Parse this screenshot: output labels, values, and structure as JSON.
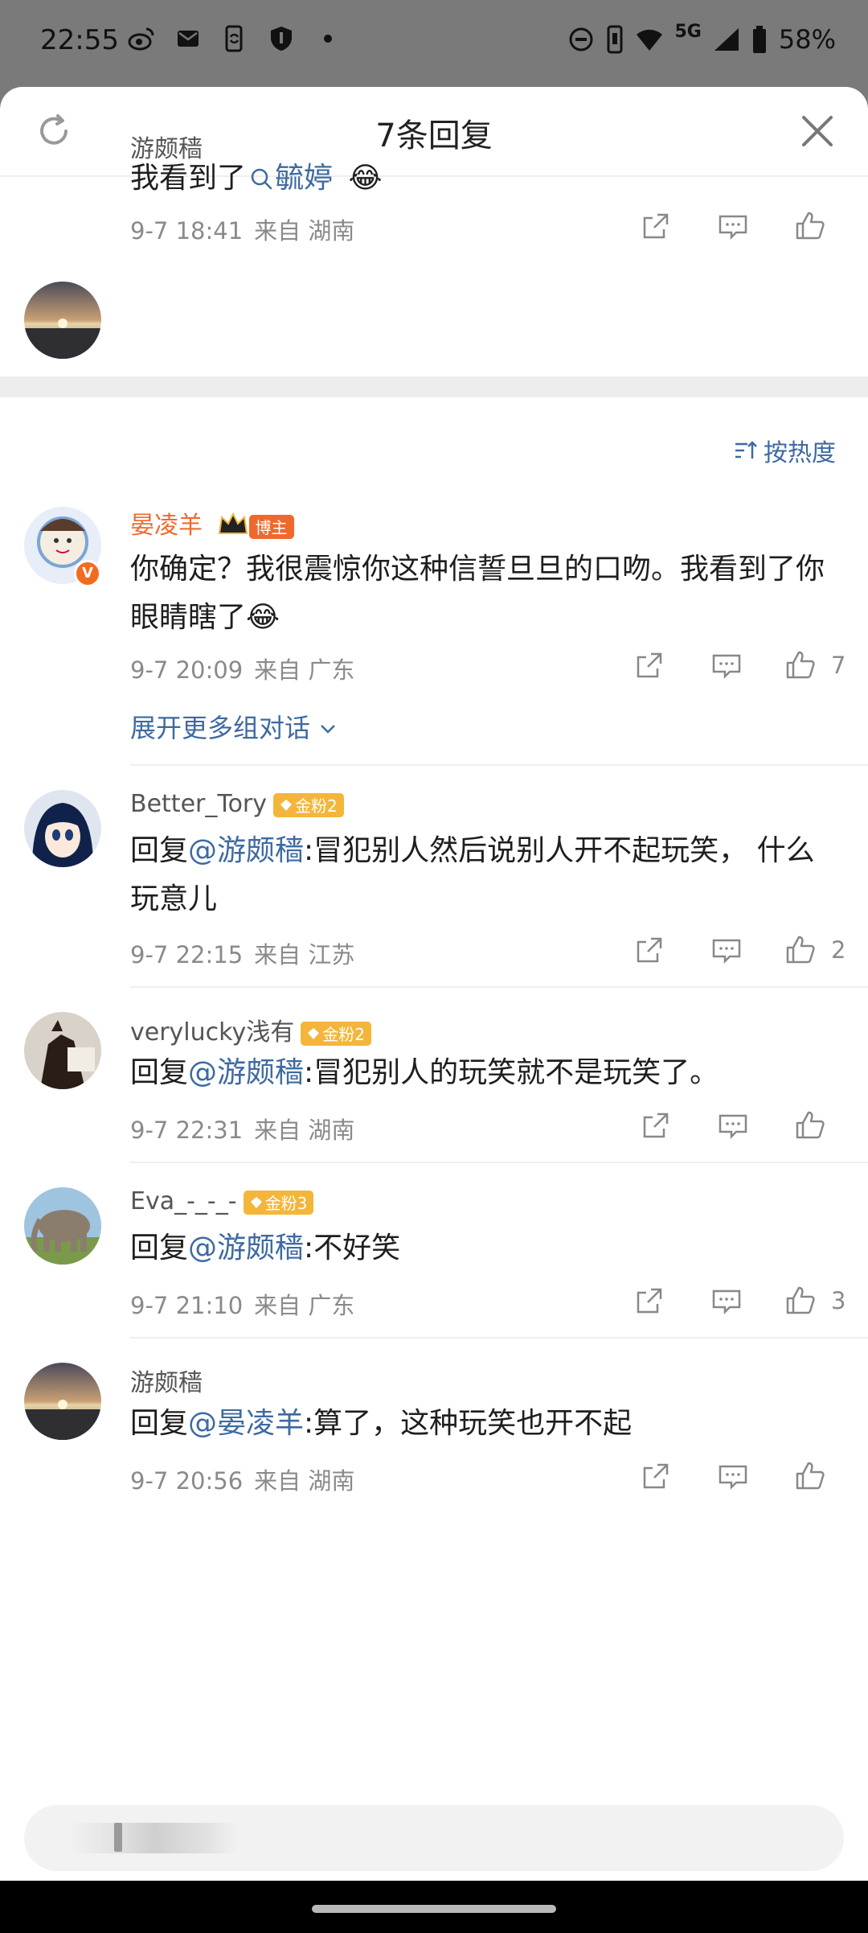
{
  "status_bar": {
    "time": "22:55",
    "left_icons": [
      "weibo-icon",
      "mail-icon",
      "phone-sync-icon",
      "shield-icon",
      "dot-icon"
    ],
    "network": "5G",
    "battery": "58%"
  },
  "sheet": {
    "title": "7条回复",
    "refresh_icon": "refresh-icon",
    "close_icon": "close-icon"
  },
  "root_comment": {
    "user": "游颇穑",
    "text_prefix": "我看到了",
    "search_tag": "毓婷",
    "emoji": "😂",
    "time": "9-7 18:41",
    "location": "来自 湖南"
  },
  "sort": {
    "label": "按热度",
    "icon": "sort-icon"
  },
  "replies": [
    {
      "user": "晏凌羊",
      "badge": "博主",
      "text": "你确定？我很震惊你这种信誓旦旦的口吻。我看到了你眼睛瞎了😂",
      "time": "9-7 20:09",
      "location": "来自 广东",
      "likes": "7"
    },
    {
      "user": "Better_Tory",
      "badge": "金粉2",
      "reply_prefix": "回复",
      "mention": "@游颇穑",
      "text": ":冒犯别人然后说别人开不起玩笑， 什么玩意儿",
      "time": "9-7 22:15",
      "location": "来自 江苏",
      "likes": "2"
    },
    {
      "user": "verylucky浅有",
      "badge": "金粉2",
      "reply_prefix": "回复",
      "mention": "@游颇穑",
      "text": ":冒犯别人的玩笑就不是玩笑了。",
      "time": "9-7 22:31",
      "location": "来自 湖南",
      "likes": ""
    },
    {
      "user": "Eva_-_-_-",
      "badge": "金粉3",
      "reply_prefix": "回复",
      "mention": "@游颇穑",
      "text": ":不好笑",
      "time": "9-7 21:10",
      "location": "来自 广东",
      "likes": "3"
    },
    {
      "user": "游颇穑",
      "reply_prefix": "回复",
      "mention": "@晏凌羊",
      "text": ":算了，这种玩笑也开不起",
      "time": "9-7 20:56",
      "location": "来自 湖南",
      "likes": ""
    }
  ],
  "expand_label": "展开更多组对话",
  "colors": {
    "link": "#3e6aa1",
    "host_name": "#f0692c",
    "fan_badge": "#f4b63a"
  }
}
